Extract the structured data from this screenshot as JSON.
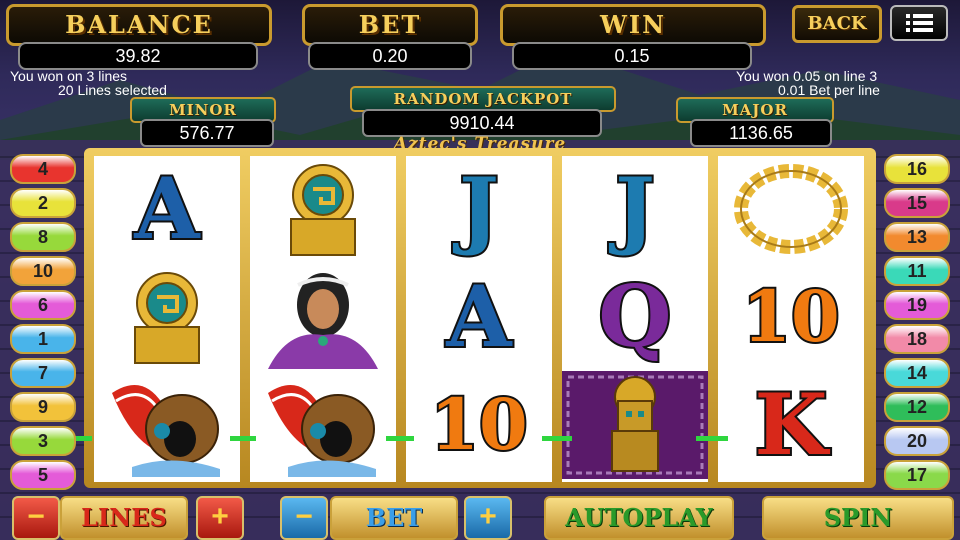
{
  "header": {
    "balance_label": "BALANCE",
    "balance_value": "39.82",
    "bet_label": "BET",
    "bet_value": "0.20",
    "win_label": "WIN",
    "win_value": "0.15",
    "back_label": "BACK",
    "menu_icon": "hamburger-menu-icon"
  },
  "messages": {
    "left_line1": "You won on 3 lines",
    "left_line2": "20 Lines selected",
    "right_line1": "You won 0.05 on line 3",
    "right_line2": "0.01 Bet per line"
  },
  "jackpots": {
    "minor_label": "MINOR",
    "minor_value": "576.77",
    "random_label": "RANDOM JACKPOT",
    "random_value": "9910.44",
    "major_label": "MAJOR",
    "major_value": "1136.65"
  },
  "game_title": "Aztec's Treasure",
  "reels": [
    [
      "A",
      "shield",
      "headdress"
    ],
    [
      "shield",
      "princess",
      "headdress"
    ],
    [
      "J",
      "A",
      "10"
    ],
    [
      "J",
      "Q",
      "idol"
    ],
    [
      "necklace",
      "10",
      "K"
    ]
  ],
  "lines_left": [
    "4",
    "2",
    "8",
    "10",
    "6",
    "1",
    "7",
    "9",
    "3",
    "5"
  ],
  "lines_right": [
    "16",
    "15",
    "13",
    "11",
    "19",
    "18",
    "14",
    "12",
    "20",
    "17"
  ],
  "colors": {
    "line_badges_left": [
      "#e8342e",
      "#e8e23a",
      "#97d93b",
      "#f2a33a",
      "#e45bd8",
      "#49b4ea",
      "#49b4ea",
      "#f2c23a",
      "#97d93b",
      "#e45bd8"
    ],
    "line_badges_right": [
      "#e8e23a",
      "#d93a8a",
      "#f28a2e",
      "#3ad9b8",
      "#e45bd8",
      "#f28aa8",
      "#49d9d9",
      "#2fbd5a",
      "#b8c8f2",
      "#8ad94a"
    ]
  },
  "controls": {
    "lines_label": "LINES",
    "bet_label": "BET",
    "autoplay_label": "AUTOPLAY",
    "spin_label": "SPIN"
  }
}
